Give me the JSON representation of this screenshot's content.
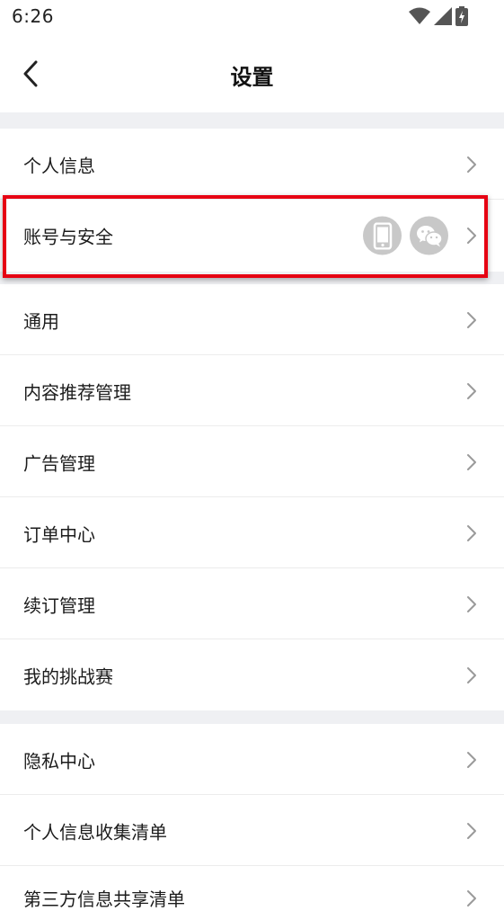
{
  "status_bar": {
    "time": "6:26"
  },
  "header": {
    "title": "设置"
  },
  "groups": [
    {
      "items": [
        {
          "label": "个人信息"
        },
        {
          "label": "账号与安全"
        }
      ]
    },
    {
      "items": [
        {
          "label": "通用"
        },
        {
          "label": "内容推荐管理"
        },
        {
          "label": "广告管理"
        },
        {
          "label": "订单中心"
        },
        {
          "label": "续订管理"
        },
        {
          "label": "我的挑战赛"
        }
      ]
    },
    {
      "items": [
        {
          "label": "隐私中心"
        },
        {
          "label": "个人信息收集清单"
        },
        {
          "label": "第三方信息共享清单"
        }
      ]
    }
  ],
  "colors": {
    "highlight": "#e60012",
    "separator": "#eff0f3",
    "badge": "#c8c8c8"
  },
  "icons": {
    "account_bindings": [
      "phone-icon",
      "wechat-icon"
    ]
  }
}
